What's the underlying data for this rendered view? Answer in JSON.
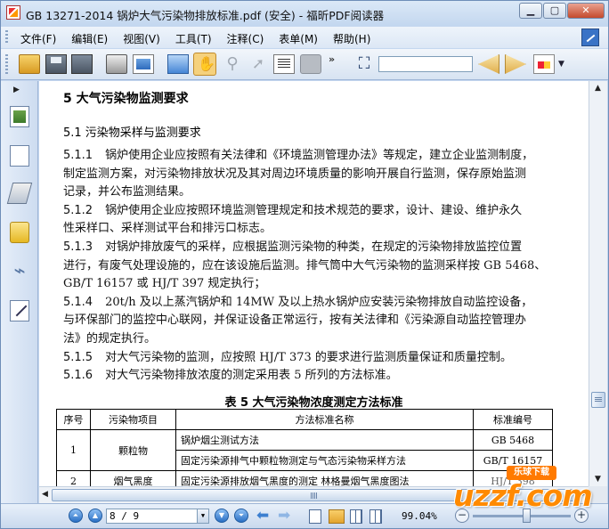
{
  "window": {
    "title": "GB 13271-2014 锅炉大气污染物排放标准.pdf (安全) - 福昕PDF阅读器"
  },
  "menu": [
    "文件(F)",
    "编辑(E)",
    "视图(V)",
    "工具(T)",
    "注释(C)",
    "表单(M)",
    "帮助(H)"
  ],
  "toolbar": {
    "more": "»",
    "find_value": ""
  },
  "document": {
    "section_title": "5   大气污染物监测要求",
    "subsection_title": "5.1  污染物采样与监测要求",
    "lines": [
      {
        "num": "5.1.1",
        "text": "锅炉使用企业应按照有关法律和《环境监测管理办法》等规定，建立企业监测制度，"
      },
      {
        "num": "",
        "text": "制定监测方案，对污染物排放状况及其对周边环境质量的影响开展自行监测，保存原始监测"
      },
      {
        "num": "",
        "text": "记录，并公布监测结果。"
      },
      {
        "num": "5.1.2",
        "text": "锅炉使用企业应按照环境监测管理规定和技术规范的要求，设计、建设、维护永久"
      },
      {
        "num": "",
        "text": "性采样口、采样测试平台和排污口标志。"
      },
      {
        "num": "5.1.3",
        "text": "对锅炉排放废气的采样，应根据监测污染物的种类，在规定的污染物排放监控位置"
      },
      {
        "num": "",
        "text": "进行，有废气处理设施的，应在该设施后监测。排气筒中大气污染物的监测采样按 GB 5468、"
      },
      {
        "num": "",
        "text": "GB/T 16157 或 HJ/T 397 规定执行；"
      },
      {
        "num": "5.1.4",
        "text": "20t/h 及以上蒸汽锅炉和 14MW 及以上热水锅炉应安装污染物排放自动监控设备，"
      },
      {
        "num": "",
        "text": "与环保部门的监控中心联网，并保证设备正常运行，按有关法律和《污染源自动监控管理办"
      },
      {
        "num": "",
        "text": "法》的规定执行。"
      },
      {
        "num": "5.1.5",
        "text": "对大气污染物的监测，应按照 HJ/T 373 的要求进行监测质量保证和质量控制。"
      },
      {
        "num": "5.1.6",
        "text": "对大气污染物排放浓度的测定采用表 5 所列的方法标准。"
      }
    ],
    "table_caption": "表 5   大气污染物浓度测定方法标准",
    "table": {
      "headers": [
        "序号",
        "污染物项目",
        "方法标准名称",
        "标准编号"
      ],
      "rows": [
        {
          "no": "1",
          "item": "颗粒物",
          "method": "锅炉烟尘测试方法",
          "code": "GB 5468"
        },
        {
          "no": "",
          "item": "",
          "method": "固定污染源排气中颗粒物测定与气态污染物采样方法",
          "code": "GB/T 16157"
        },
        {
          "no": "2",
          "item": "烟气黑度",
          "method": "固定污染源排放烟气黑度的测定   林格曼烟气黑度图法",
          "code": "HJ/T 398"
        }
      ]
    }
  },
  "statusbar": {
    "page_value": "8 / 9",
    "zoom": "99.04%"
  },
  "watermark": {
    "badge": "乐球下载",
    "logo": "uzzf.com"
  }
}
